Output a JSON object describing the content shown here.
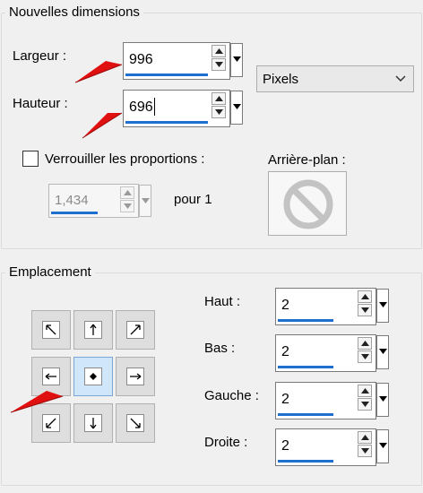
{
  "nouvelles_dimensions": {
    "title": "Nouvelles dimensions",
    "largeur_label": "Largeur :",
    "largeur_value": "996",
    "hauteur_label": "Hauteur :",
    "hauteur_value": "696",
    "unit": "Pixels",
    "lock_label": "Verrouiller les proportions :",
    "lock_checked": false,
    "ratio_value": "1,434",
    "ratio_suffix": "pour 1",
    "arriere_plan_label": "Arrière-plan :"
  },
  "emplacement": {
    "title": "Emplacement",
    "haut_label": "Haut :",
    "haut_value": "2",
    "bas_label": "Bas :",
    "bas_value": "2",
    "gauche_label": "Gauche :",
    "gauche_value": "2",
    "droite_label": "Droite :",
    "droite_value": "2",
    "selected_anchor": "center"
  },
  "colors": {
    "accent": "#1f6fd1",
    "selection": "#cfe6fb",
    "annotation_arrow": "#e01010"
  }
}
